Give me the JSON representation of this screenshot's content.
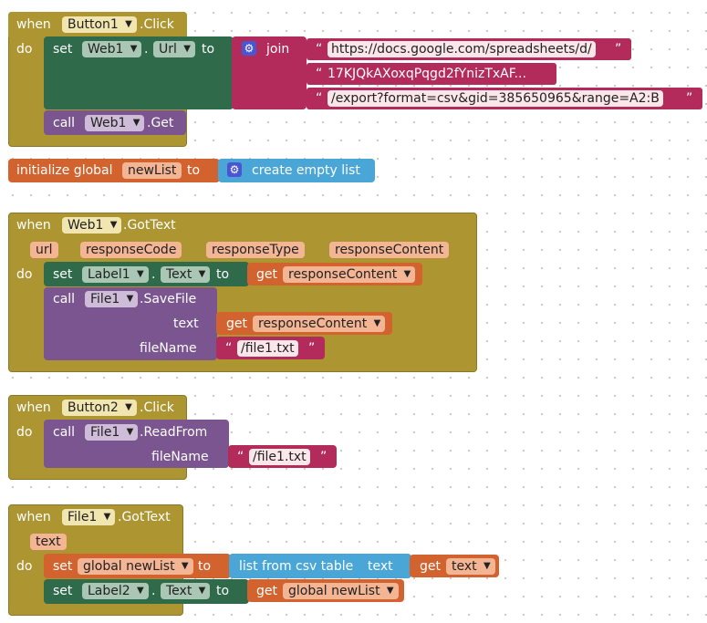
{
  "colors": {
    "event": "#ad9532",
    "event_dark": "#8a7826",
    "setter_green": "#2f6b4b",
    "text_pink": "#b22b5b",
    "component_purple": "#7a5590",
    "variable_orange": "#d3632e",
    "list_blue": "#4ba6d8"
  },
  "kw": {
    "when": "when",
    "do": "do",
    "set": "set",
    "to": "to",
    "call": "call",
    "join": "join",
    "get": "get",
    "dot": ".",
    "quote": "“",
    "quote_close": "”",
    "initialize_global": "initialize global",
    "create_empty_list": "create empty list",
    "list_from_csv_table": "list from csv table",
    "text_socket": "text",
    "text_label": "text",
    "filename_label": "fileName"
  },
  "block1": {
    "component": "Button1",
    "event": ".Click",
    "setter_component": "Web1",
    "setter_prop": "Url",
    "join_items": [
      "https://docs.google.com/spreadsheets/d/",
      "17KJQkAXoxqPqgd2fYnizTxAF...",
      "/export?format=csv&gid=385650965&range=A2:B"
    ],
    "call_component": "Web1",
    "call_method": ".Get"
  },
  "global": {
    "name": "newList"
  },
  "block2": {
    "component": "Web1",
    "event": ".GotText",
    "params": [
      "url",
      "responseCode",
      "responseType",
      "responseContent"
    ],
    "set_component": "Label1",
    "set_prop": "Text",
    "get_var": "responseContent",
    "call_component": "File1",
    "call_method": ".SaveFile",
    "text_get": "responseContent",
    "filename": "/file1.txt"
  },
  "block3": {
    "component": "Button2",
    "event": ".Click",
    "call_component": "File1",
    "call_method": ".ReadFrom",
    "filename": "/file1.txt"
  },
  "block4": {
    "component": "File1",
    "event": ".GotText",
    "param": "text",
    "set1_var": "global newList",
    "get_text": "text",
    "set2_component": "Label2",
    "set2_prop": "Text",
    "get_global": "global newList"
  }
}
